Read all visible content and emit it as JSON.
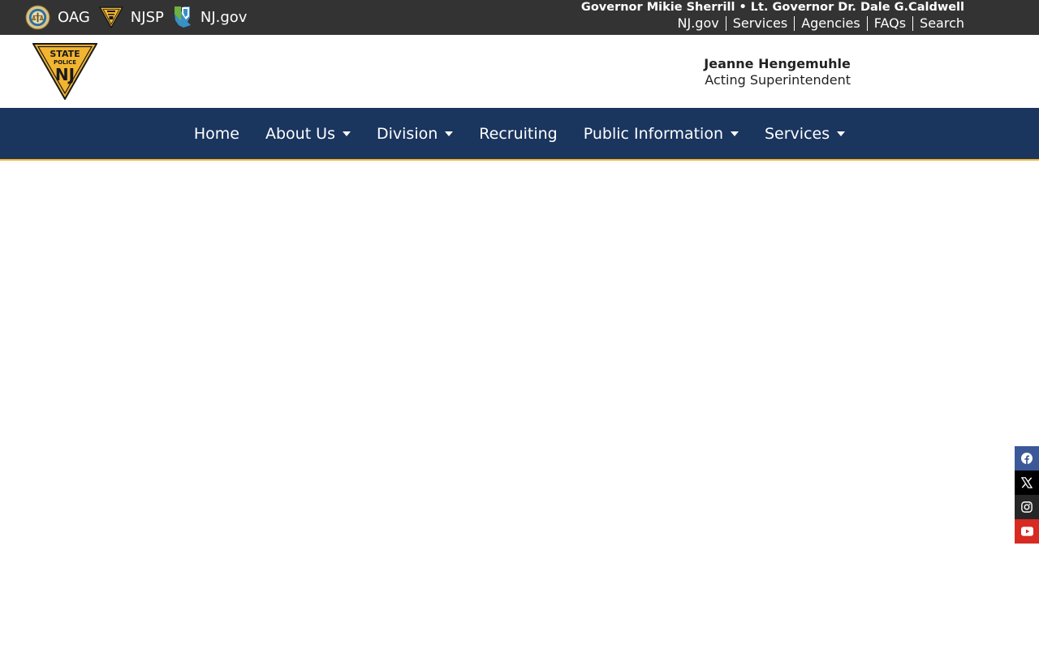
{
  "topbar": {
    "brand_links": [
      {
        "label": "OAG",
        "icon": "oag-seal-icon"
      },
      {
        "label": "NJSP",
        "icon": "njsp-badge-icon"
      },
      {
        "label": "NJ.gov",
        "icon": "nj-state-icon"
      }
    ],
    "governor_line": "Governor Mikie Sherrill • Lt. Governor Dr. Dale G.Caldwell",
    "utility_links": [
      "NJ.gov",
      "Services",
      "Agencies",
      "FAQs",
      "Search"
    ]
  },
  "header": {
    "logo_icon": "state-police-nj-badge-icon",
    "superintendent_name": "Jeanne Hengemuhle",
    "superintendent_title": "Acting Superintendent"
  },
  "main_nav": {
    "items": [
      {
        "label": "Home",
        "has_dropdown": false
      },
      {
        "label": "About Us",
        "has_dropdown": true
      },
      {
        "label": "Division",
        "has_dropdown": true
      },
      {
        "label": "Recruiting",
        "has_dropdown": false
      },
      {
        "label": "Public Information",
        "has_dropdown": true
      },
      {
        "label": "Services",
        "has_dropdown": true
      }
    ]
  },
  "social": {
    "items": [
      {
        "icon": "facebook-icon",
        "color": "#3b5998"
      },
      {
        "icon": "x-icon",
        "color": "#000000"
      },
      {
        "icon": "instagram-icon",
        "color": "#262626"
      },
      {
        "icon": "youtube-icon",
        "color": "#d72a22"
      }
    ]
  },
  "colors": {
    "topbar_bg": "#333333",
    "nav_bg": "#1a355e",
    "accent_gold": "#f2b531"
  }
}
